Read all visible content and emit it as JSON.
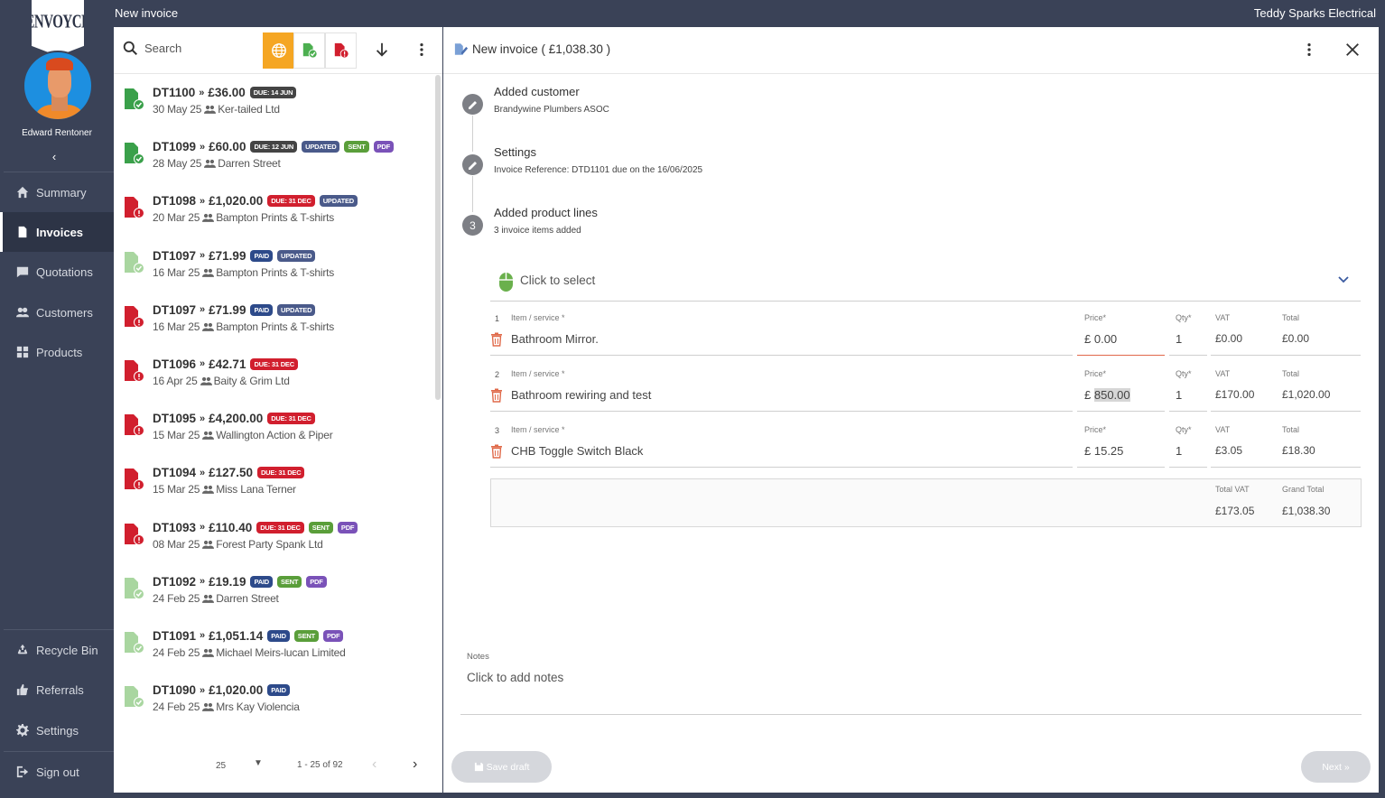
{
  "app": {
    "logo_text": "ENVOYCE",
    "user_name": "Edward Rentoner",
    "window_title": "New invoice",
    "company": "Teddy Sparks Electrical"
  },
  "sidebar": {
    "collapse": "‹",
    "items": [
      {
        "label": "Summary",
        "icon": "home-icon"
      },
      {
        "label": "Invoices",
        "icon": "invoice-icon",
        "active": true
      },
      {
        "label": "Quotations",
        "icon": "quote-icon"
      },
      {
        "label": "Customers",
        "icon": "people-icon"
      },
      {
        "label": "Products",
        "icon": "products-icon"
      }
    ],
    "bottom_items": [
      {
        "label": "Recycle Bin",
        "icon": "recycle-icon"
      },
      {
        "label": "Referrals",
        "icon": "thumbs-up-icon"
      },
      {
        "label": "Settings",
        "icon": "gear-icon"
      },
      {
        "label": "Sign out",
        "icon": "sign-out-icon"
      }
    ]
  },
  "list": {
    "search_placeholder": "Search",
    "accent": "#f5a623",
    "invoices": [
      {
        "id": "DT1100",
        "amount": "£36.00",
        "status": "green",
        "badges": [
          {
            "t": "DUE: 14 JUN",
            "c": "due"
          }
        ],
        "date": "30 May 25",
        "customer": "Ker-tailed Ltd"
      },
      {
        "id": "DT1099",
        "amount": "£60.00",
        "status": "green",
        "badges": [
          {
            "t": "DUE: 12 JUN",
            "c": "due"
          },
          {
            "t": "UPDATED",
            "c": "updated"
          },
          {
            "t": "SENT",
            "c": "sent"
          },
          {
            "t": "PDF",
            "c": "pdf"
          }
        ],
        "date": "28 May 25",
        "customer": "Darren Street"
      },
      {
        "id": "DT1098",
        "amount": "£1,020.00",
        "status": "red",
        "badges": [
          {
            "t": "DUE: 31 DEC",
            "c": "due-red"
          },
          {
            "t": "UPDATED",
            "c": "updated"
          }
        ],
        "date": "20 Mar 25",
        "customer": "Bampton Prints & T-shirts"
      },
      {
        "id": "DT1097",
        "amount": "£71.99",
        "status": "lightgreen",
        "badges": [
          {
            "t": "PAID",
            "c": "paid"
          },
          {
            "t": "UPDATED",
            "c": "updated"
          }
        ],
        "date": "16 Mar 25",
        "customer": "Bampton Prints & T-shirts"
      },
      {
        "id": "DT1097",
        "amount": "£71.99",
        "status": "red",
        "badges": [
          {
            "t": "PAID",
            "c": "paid"
          },
          {
            "t": "UPDATED",
            "c": "updated"
          }
        ],
        "date": "16 Mar 25",
        "customer": "Bampton Prints & T-shirts"
      },
      {
        "id": "DT1096",
        "amount": "£42.71",
        "status": "red",
        "badges": [
          {
            "t": "DUE: 31 DEC",
            "c": "due-red"
          }
        ],
        "date": "16 Apr 25",
        "customer": "Baity & Grim Ltd"
      },
      {
        "id": "DT1095",
        "amount": "£4,200.00",
        "status": "red",
        "badges": [
          {
            "t": "DUE: 31 DEC",
            "c": "due-red"
          }
        ],
        "date": "15 Mar 25",
        "customer": "Wallington Action & Piper"
      },
      {
        "id": "DT1094",
        "amount": "£127.50",
        "status": "red",
        "badges": [
          {
            "t": "DUE: 31 DEC",
            "c": "due-red"
          }
        ],
        "date": "15 Mar 25",
        "customer": "Miss Lana Terner"
      },
      {
        "id": "DT1093",
        "amount": "£110.40",
        "status": "red",
        "badges": [
          {
            "t": "DUE: 31 DEC",
            "c": "due-red"
          },
          {
            "t": "SENT",
            "c": "sent"
          },
          {
            "t": "PDF",
            "c": "pdf"
          }
        ],
        "date": "08 Mar 25",
        "customer": "Forest Party Spank Ltd"
      },
      {
        "id": "DT1092",
        "amount": "£19.19",
        "status": "lightgreen",
        "badges": [
          {
            "t": "PAID",
            "c": "paid"
          },
          {
            "t": "SENT",
            "c": "sent"
          },
          {
            "t": "PDF",
            "c": "pdf"
          }
        ],
        "date": "24 Feb 25",
        "customer": "Darren Street"
      },
      {
        "id": "DT1091",
        "amount": "£1,051.14",
        "status": "lightgreen",
        "badges": [
          {
            "t": "PAID",
            "c": "paid"
          },
          {
            "t": "SENT",
            "c": "sent"
          },
          {
            "t": "PDF",
            "c": "pdf"
          }
        ],
        "date": "24 Feb 25",
        "customer": "Michael Meirs-lucan Limited"
      },
      {
        "id": "DT1090",
        "amount": "£1,020.00",
        "status": "lightgreen",
        "badges": [
          {
            "t": "PAID",
            "c": "paid"
          }
        ],
        "date": "24 Feb 25",
        "customer": "Mrs Kay Violencia"
      }
    ],
    "pagination": {
      "per_page": "25",
      "range": "1 - 25 of 92"
    }
  },
  "invoice": {
    "title": "New invoice ( £1,038.30 )",
    "steps": [
      {
        "title": "Added customer",
        "sub": "Brandywine Plumbers ASOC",
        "marker": "edit"
      },
      {
        "title": "Settings",
        "sub": "Invoice Reference: DTD1101 due on the 16/06/2025",
        "marker": "edit"
      },
      {
        "title": "Added product lines",
        "sub": "3 invoice items added",
        "marker": "3"
      }
    ],
    "select_label": "Click to select",
    "labels": {
      "item": "Item / service *",
      "price": "Price*",
      "qty": "Qty*",
      "vat": "VAT",
      "total": "Total"
    },
    "lines": [
      {
        "n": "1",
        "item": "Bathroom Mirror.",
        "currency": "£",
        "price": "0.00",
        "qty": "1",
        "vat": "£0.00",
        "total": "£0.00"
      },
      {
        "n": "2",
        "item": "Bathroom rewiring and test",
        "currency": "£",
        "price": "850.00",
        "qty": "1",
        "vat": "£170.00",
        "total": "£1,020.00"
      },
      {
        "n": "3",
        "item": "CHB Toggle Switch Black",
        "currency": "£",
        "price": "15.25",
        "qty": "1",
        "vat": "£3.05",
        "total": "£18.30"
      }
    ],
    "totals": {
      "vat_label": "Total VAT",
      "vat": "£173.05",
      "grand_label": "Grand Total",
      "grand": "£1,038.30"
    },
    "notes_label": "Notes",
    "notes_placeholder": "Click to add notes",
    "save_draft": "Save draft",
    "next": "Next »"
  }
}
